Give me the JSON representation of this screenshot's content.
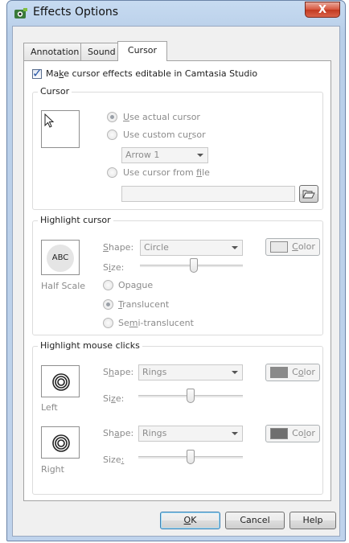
{
  "window": {
    "title": "Effects Options",
    "close_glyph": "X",
    "icon": "camtasia-app-icon"
  },
  "tabs": [
    {
      "label": "Annotation",
      "active": false
    },
    {
      "label": "Sound",
      "active": false
    },
    {
      "label": "Cursor",
      "active": true
    }
  ],
  "editable_checkbox": {
    "label_pre": "Ma",
    "label_key": "k",
    "label_post": "e cursor effects editable in Camtasia Studio",
    "checked": true
  },
  "cursor_group": {
    "legend": "Cursor",
    "preview_icon": "arrow-pointer-icon",
    "options": [
      {
        "pre": "",
        "key": "U",
        "post": "se actual cursor",
        "selected": true
      },
      {
        "pre": "Use custom cu",
        "key": "r",
        "post": "sor",
        "selected": false
      },
      {
        "pre": "Use cursor from ",
        "key": "f",
        "post": "ile",
        "selected": false
      }
    ],
    "custom_select_value": "Arrow 1",
    "file_path_value": "",
    "browse_icon": "open-folder-icon"
  },
  "highlight_group": {
    "legend": "Highlight cursor",
    "preview_text": "ABC",
    "preview_caption": "Half Scale",
    "shape_label_key": "S",
    "shape_label_post": "hape:",
    "shape_value": "Circle",
    "size_label_pre": "S",
    "size_label_key": "i",
    "size_label_post": "ze:",
    "size_percent": 52,
    "color_button": {
      "key": "C",
      "post": "olor",
      "swatch": "#e8e8e8"
    },
    "options": [
      {
        "pre": "Opa",
        "key": "q",
        "post": "ue",
        "selected": false
      },
      {
        "pre": "",
        "key": "T",
        "post": "ranslucent",
        "selected": true
      },
      {
        "pre": "Se",
        "key": "m",
        "post": "i-translucent",
        "selected": false
      }
    ]
  },
  "clicks_group": {
    "legend": "Highlight mouse clicks",
    "rows": [
      {
        "caption": "Left",
        "preview_icon": "rings-icon",
        "shape_label_pre": "S",
        "shape_label_key": "h",
        "shape_label_post": "ape:",
        "shape_value": "Rings",
        "size_label_pre": "Si",
        "size_label_key": "z",
        "size_label_post": "e:",
        "size_percent": 50,
        "color_pre": "C",
        "color_key": "o",
        "color_post": "lor",
        "swatch": "#8a8a8a"
      },
      {
        "caption": "Right",
        "preview_icon": "rings-icon",
        "shape_label_pre": "Sh",
        "shape_label_key": "a",
        "shape_label_post": "pe:",
        "shape_value": "Rings",
        "size_label_pre": "Size",
        "size_label_key": ":",
        "size_label_post": "",
        "size_percent": 50,
        "color_pre": "Co",
        "color_key": "l",
        "color_post": "or",
        "swatch": "#6f6f6f"
      }
    ]
  },
  "footer": {
    "ok_label": "OK",
    "ok_key": "O",
    "cancel_label": "Cancel",
    "help_label": "Help"
  }
}
